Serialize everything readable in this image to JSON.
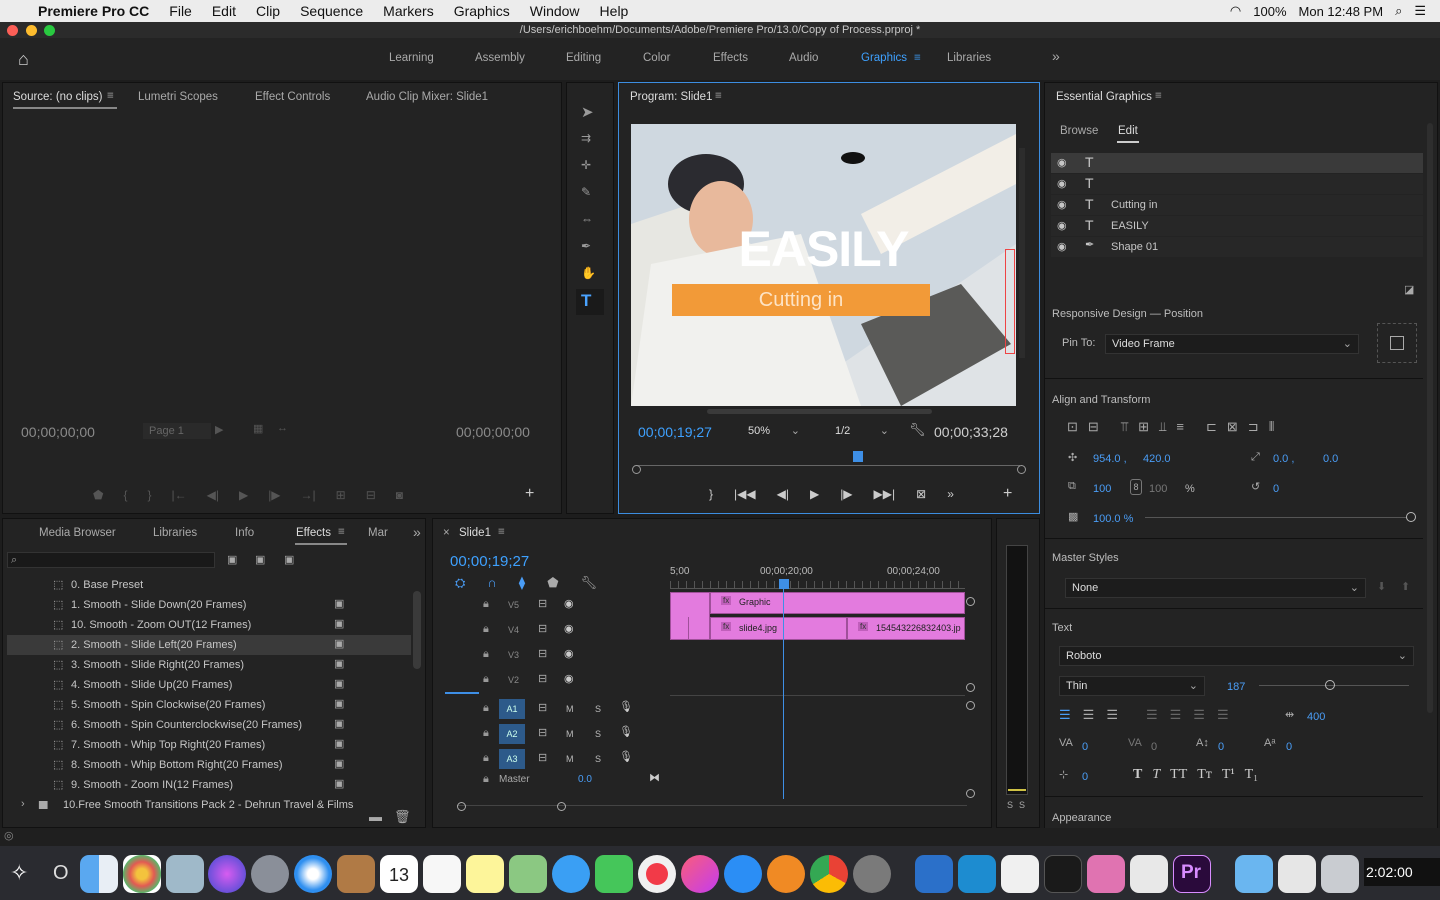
{
  "menubar": {
    "apple": "",
    "app": "Premiere Pro CC",
    "items": [
      "File",
      "Edit",
      "Clip",
      "Sequence",
      "Markers",
      "Graphics",
      "Window",
      "Help"
    ],
    "battery": "100%",
    "clock": "Mon 12:48 PM"
  },
  "titlebar": {
    "path": "/Users/erichboehm/Documents/Adobe/Premiere Pro/13.0/Copy of Process.prproj *"
  },
  "workspaces": {
    "tabs": [
      "Learning",
      "Assembly",
      "Editing",
      "Color",
      "Effects",
      "Audio",
      "Graphics",
      "Libraries"
    ],
    "active": "Graphics",
    "more": "»"
  },
  "source": {
    "tabs": [
      "Source: (no clips)",
      "Lumetri Scopes",
      "Effect Controls",
      "Audio Clip Mixer: Slide1"
    ],
    "tc_left": "00;00;00;00",
    "tc_right": "00;00;00;00",
    "page": "Page 1"
  },
  "program": {
    "title": "Program: Slide1",
    "tc_current": "00;00;19;27",
    "zoom": "50%",
    "quality": "1/2",
    "tc_duration": "00;00;33;28",
    "overlay_title": "EASILY",
    "overlay_sub": "Cutting in"
  },
  "eg": {
    "title": "Essential Graphics",
    "tabs": [
      "Browse",
      "Edit"
    ],
    "layers": [
      {
        "name": ""
      },
      {
        "name": ""
      },
      {
        "name": "Cutting in"
      },
      {
        "name": "EASILY"
      },
      {
        "name": "Shape 01"
      }
    ],
    "responsive": "Responsive Design — Position",
    "pin_label": "Pin To:",
    "pin_value": "Video Frame",
    "align": "Align and Transform",
    "pos_x": "954.0 ,",
    "pos_y": "420.0",
    "anchor_x": "0.0 ,",
    "anchor_y": "0.0",
    "scale_w": "100",
    "scale_h": "100",
    "pct": "%",
    "rotation": "0",
    "opacity": "100.0 %",
    "master_styles": "Master Styles",
    "master_value": "None",
    "text_section": "Text",
    "font": "Roboto",
    "weight": "Thin",
    "size": "187",
    "tracking": "400",
    "kern": "0",
    "leading": "0",
    "baseline": "0",
    "tsume": "0",
    "tabwidth": "0",
    "styles": [
      "T",
      "T",
      "TT",
      "Tт",
      "T¹",
      "T₁"
    ],
    "appearance": "Appearance"
  },
  "project": {
    "tabs": [
      "Media Browser",
      "Libraries",
      "Info",
      "Effects",
      "Mar"
    ],
    "active": "Effects",
    "items": [
      "0. Base Preset",
      "1. Smooth - Slide Down(20 Frames)",
      "10. Smooth - Zoom OUT(12 Frames)",
      "2. Smooth - Slide Left(20 Frames)",
      "3. Smooth - Slide Right(20 Frames)",
      "4. Smooth - Slide Up(20 Frames)",
      "5. Smooth - Spin Clockwise(20 Frames)",
      "6. Smooth - Spin Counterclockwise(20 Frames)",
      "7. Smooth - Whip Top Right(20 Frames)",
      "8. Smooth - Whip Bottom Right(20 Frames)",
      "9. Smooth - Zoom IN(12 Frames)",
      "10.Free Smooth Transitions Pack 2 - Dehrun Travel & Films"
    ]
  },
  "timeline": {
    "tab": "Slide1",
    "tc": "00;00;19;27",
    "ruler": [
      "5;00",
      "00;00;20;00",
      "00;00;24;00"
    ],
    "video_tracks": [
      "V5",
      "V4",
      "V3",
      "V2"
    ],
    "audio_tracks": [
      "A1",
      "A2",
      "A3"
    ],
    "master": "Master",
    "master_val": "0.0",
    "clip_graphic": "Graphic",
    "clip_slide4": "slide4.jpg",
    "clip_other": "154543226832403.jp",
    "m": "M",
    "s": "S"
  },
  "meter": {
    "s1": "S",
    "s2": "S"
  },
  "dock": {
    "clock": "2:02:00",
    "left_text": "O"
  }
}
